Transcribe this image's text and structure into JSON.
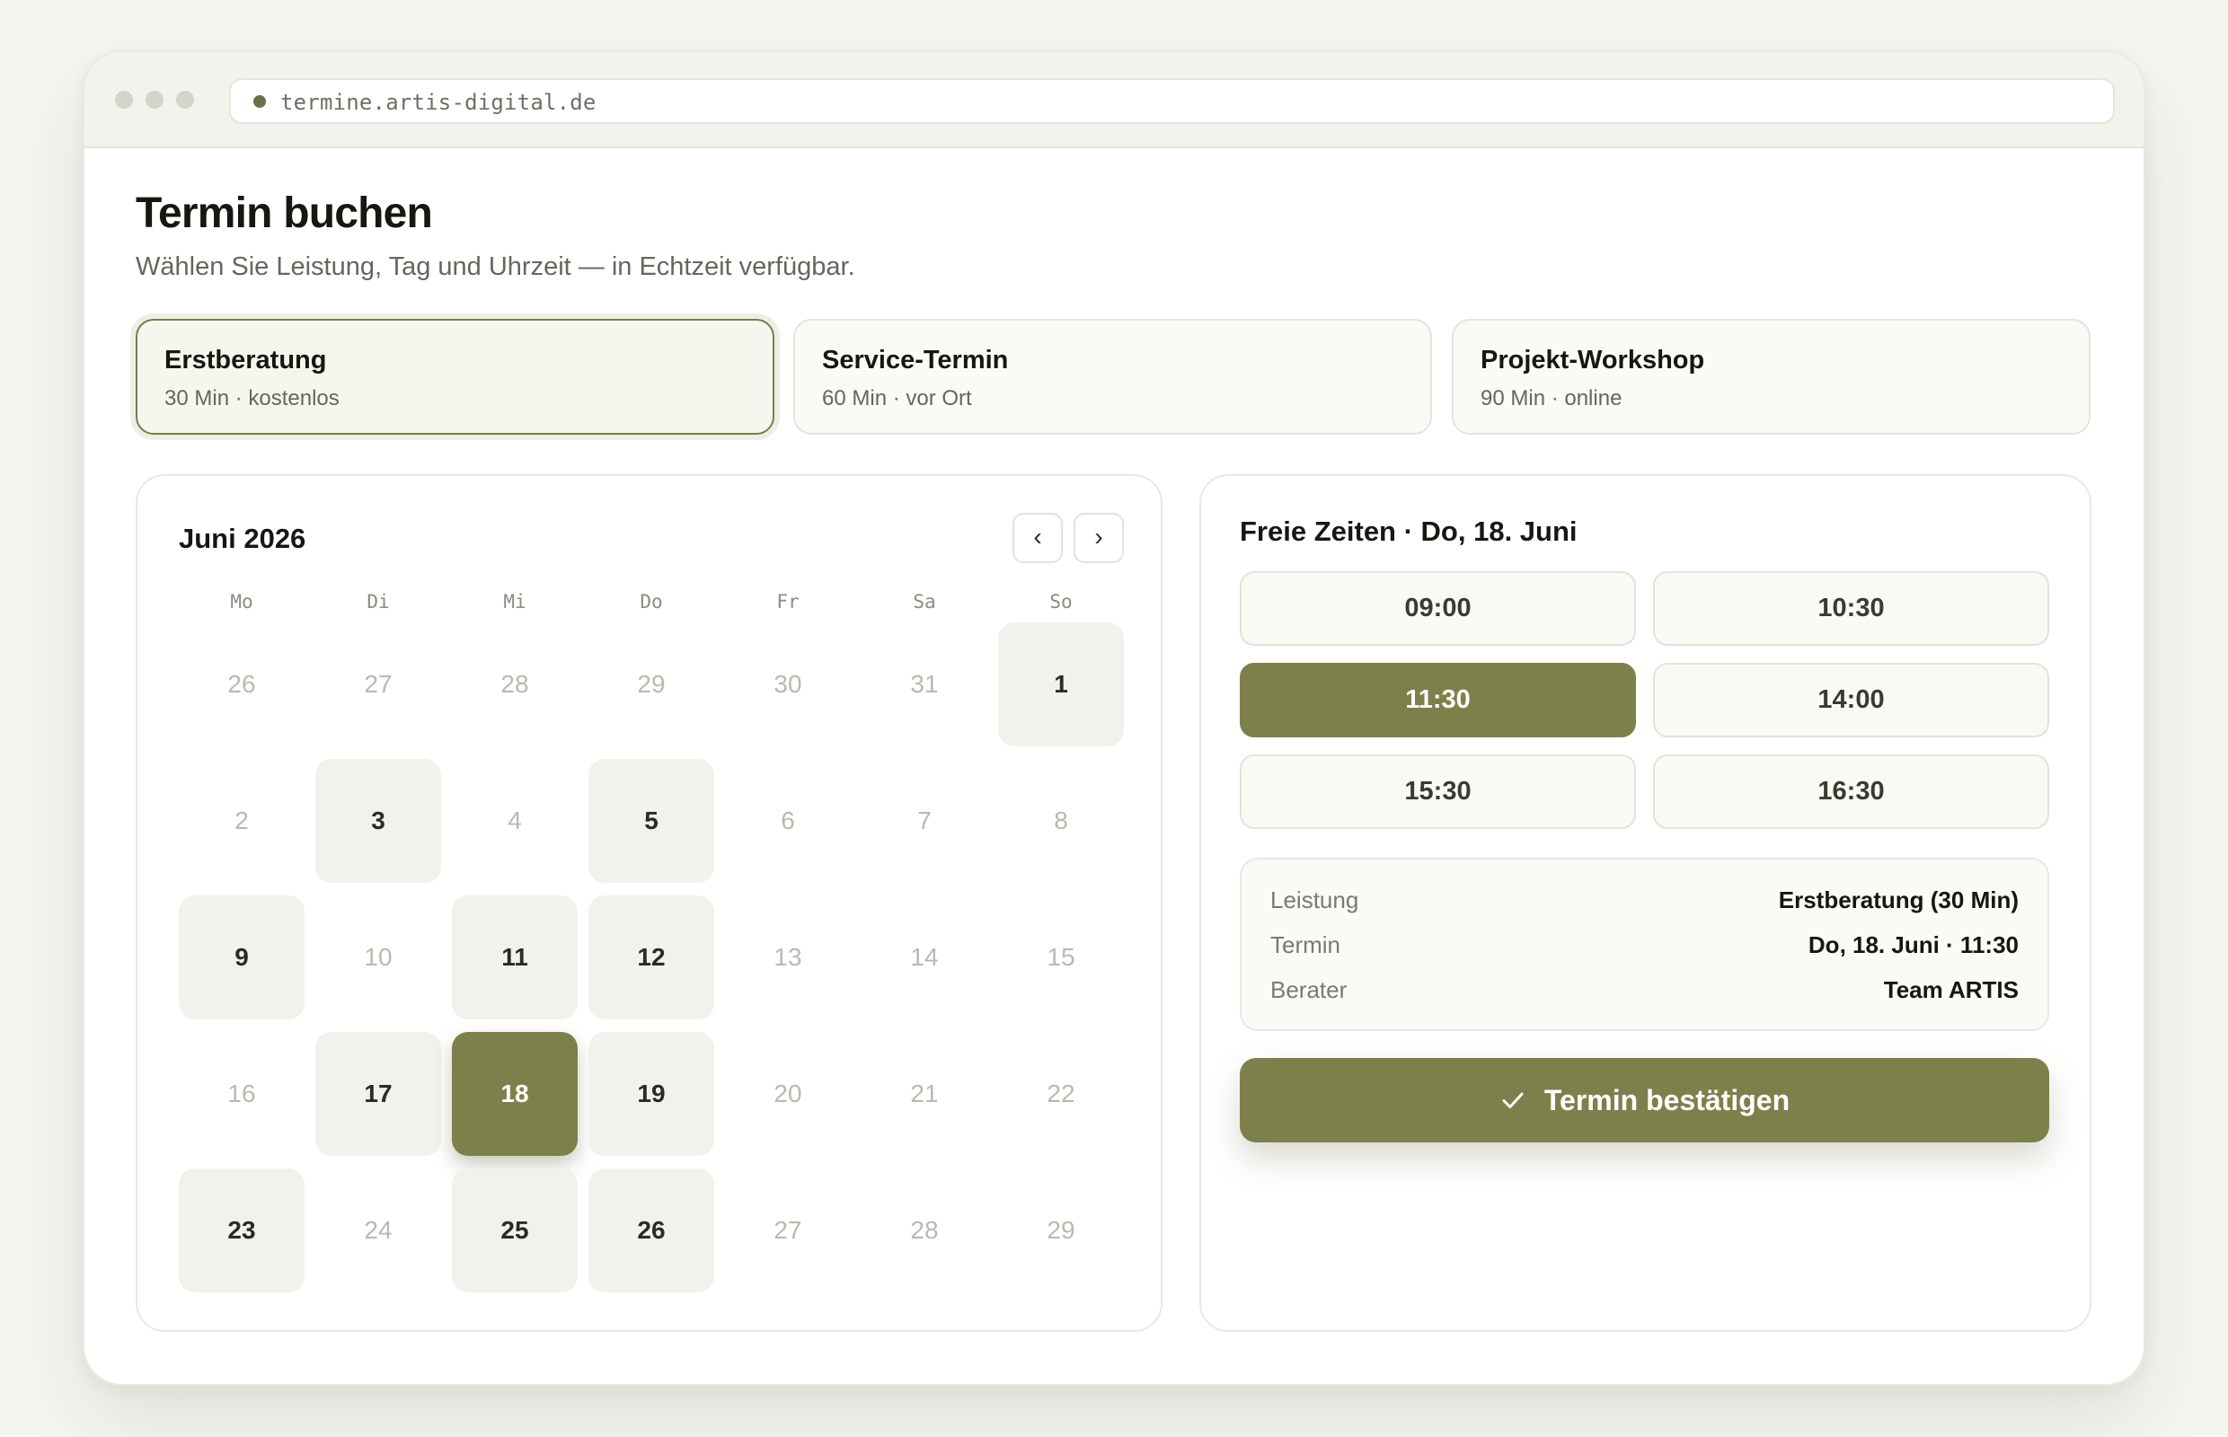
{
  "browser": {
    "url": "termine.artis-digital.de"
  },
  "page": {
    "title": "Termin buchen",
    "subtitle": "Wählen Sie Leistung, Tag und Uhrzeit — in Echtzeit verfügbar."
  },
  "services": [
    {
      "name": "Erstberatung",
      "meta": "30 Min · kostenlos",
      "selected": true
    },
    {
      "name": "Service-Termin",
      "meta": "60 Min · vor Ort",
      "selected": false
    },
    {
      "name": "Projekt-Workshop",
      "meta": "90 Min · online",
      "selected": false
    }
  ],
  "calendar": {
    "month_label": "Juni 2026",
    "prev_label": "‹",
    "next_label": "›",
    "weekdays": [
      "Mo",
      "Di",
      "Mi",
      "Do",
      "Fr",
      "Sa",
      "So"
    ],
    "weeks": [
      [
        {
          "day": "26",
          "state": "muted"
        },
        {
          "day": "27",
          "state": "muted"
        },
        {
          "day": "28",
          "state": "muted"
        },
        {
          "day": "29",
          "state": "muted"
        },
        {
          "day": "30",
          "state": "muted"
        },
        {
          "day": "31",
          "state": "muted"
        },
        {
          "day": "1",
          "state": "available"
        }
      ],
      [
        {
          "day": "2",
          "state": "muted"
        },
        {
          "day": "3",
          "state": "available"
        },
        {
          "day": "4",
          "state": "muted"
        },
        {
          "day": "5",
          "state": "available"
        },
        {
          "day": "6",
          "state": "muted"
        },
        {
          "day": "7",
          "state": "muted"
        },
        {
          "day": "8",
          "state": "muted"
        }
      ],
      [
        {
          "day": "9",
          "state": "available"
        },
        {
          "day": "10",
          "state": "muted"
        },
        {
          "day": "11",
          "state": "available"
        },
        {
          "day": "12",
          "state": "available"
        },
        {
          "day": "13",
          "state": "muted"
        },
        {
          "day": "14",
          "state": "muted"
        },
        {
          "day": "15",
          "state": "muted"
        }
      ],
      [
        {
          "day": "16",
          "state": "muted"
        },
        {
          "day": "17",
          "state": "available"
        },
        {
          "day": "18",
          "state": "selected"
        },
        {
          "day": "19",
          "state": "available"
        },
        {
          "day": "20",
          "state": "muted"
        },
        {
          "day": "21",
          "state": "muted"
        },
        {
          "day": "22",
          "state": "muted"
        }
      ],
      [
        {
          "day": "23",
          "state": "available"
        },
        {
          "day": "24",
          "state": "muted"
        },
        {
          "day": "25",
          "state": "available"
        },
        {
          "day": "26",
          "state": "available"
        },
        {
          "day": "27",
          "state": "muted"
        },
        {
          "day": "28",
          "state": "muted"
        },
        {
          "day": "29",
          "state": "muted"
        }
      ]
    ]
  },
  "slots": {
    "title": "Freie Zeiten · Do, 18. Juni",
    "times": [
      {
        "time": "09:00",
        "selected": false
      },
      {
        "time": "10:30",
        "selected": false
      },
      {
        "time": "11:30",
        "selected": true
      },
      {
        "time": "14:00",
        "selected": false
      },
      {
        "time": "15:30",
        "selected": false
      },
      {
        "time": "16:30",
        "selected": false
      }
    ]
  },
  "summary": [
    {
      "label": "Leistung",
      "value": "Erstberatung (30 Min)"
    },
    {
      "label": "Termin",
      "value": "Do, 18. Juni · 11:30"
    },
    {
      "label": "Berater",
      "value": "Team ARTIS"
    }
  ],
  "confirm": {
    "label": "Termin bestätigen",
    "icon": "check-icon"
  },
  "colors": {
    "accent": "#7e804c",
    "background": "#f6f6f1",
    "available_day": "#f2f2ec"
  }
}
